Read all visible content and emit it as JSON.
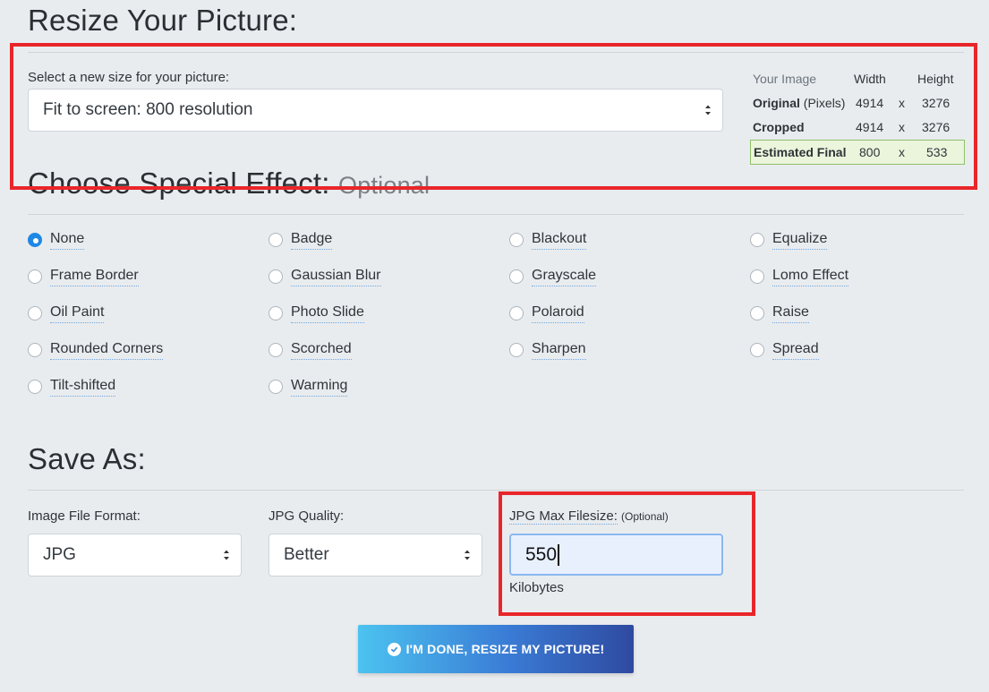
{
  "resize": {
    "title": "Resize Your Picture:",
    "select_label": "Select a new size for your picture:",
    "selected_size": "Fit to screen: 800 resolution",
    "table": {
      "header": [
        "Your Image",
        "Width",
        "",
        "Height"
      ],
      "rows": [
        {
          "label": "Original",
          "label_suffix": "(Pixels)",
          "width": "4914",
          "sep": "x",
          "height": "3276"
        },
        {
          "label": "Cropped",
          "label_suffix": "",
          "width": "4914",
          "sep": "x",
          "height": "3276"
        },
        {
          "label": "Estimated Final",
          "label_suffix": "",
          "width": "800",
          "sep": "x",
          "height": "533"
        }
      ]
    }
  },
  "effects": {
    "title": "Choose Special Effect:",
    "optional": "Optional",
    "selected": "None",
    "options": [
      "None",
      "Badge",
      "Blackout",
      "Equalize",
      "Frame Border",
      "Gaussian Blur",
      "Grayscale",
      "Lomo Effect",
      "Oil Paint",
      "Photo Slide",
      "Polaroid",
      "Raise",
      "Rounded Corners",
      "Scorched",
      "Sharpen",
      "Spread",
      "Tilt-shifted",
      "Warming"
    ]
  },
  "save": {
    "title": "Save As:",
    "format_label": "Image File Format:",
    "format_value": "JPG",
    "quality_label": "JPG Quality:",
    "quality_value": "Better",
    "maxsize_label": "JPG Max Filesize:",
    "maxsize_optional": "(Optional)",
    "maxsize_value": "550",
    "maxsize_unit": "Kilobytes"
  },
  "submit": {
    "label": "I'M DONE, RESIZE MY PICTURE!"
  },
  "colors": {
    "accent": "#1e88e5",
    "highlight_border": "#e8262a",
    "final_row_bg": "#eaf5dc"
  }
}
